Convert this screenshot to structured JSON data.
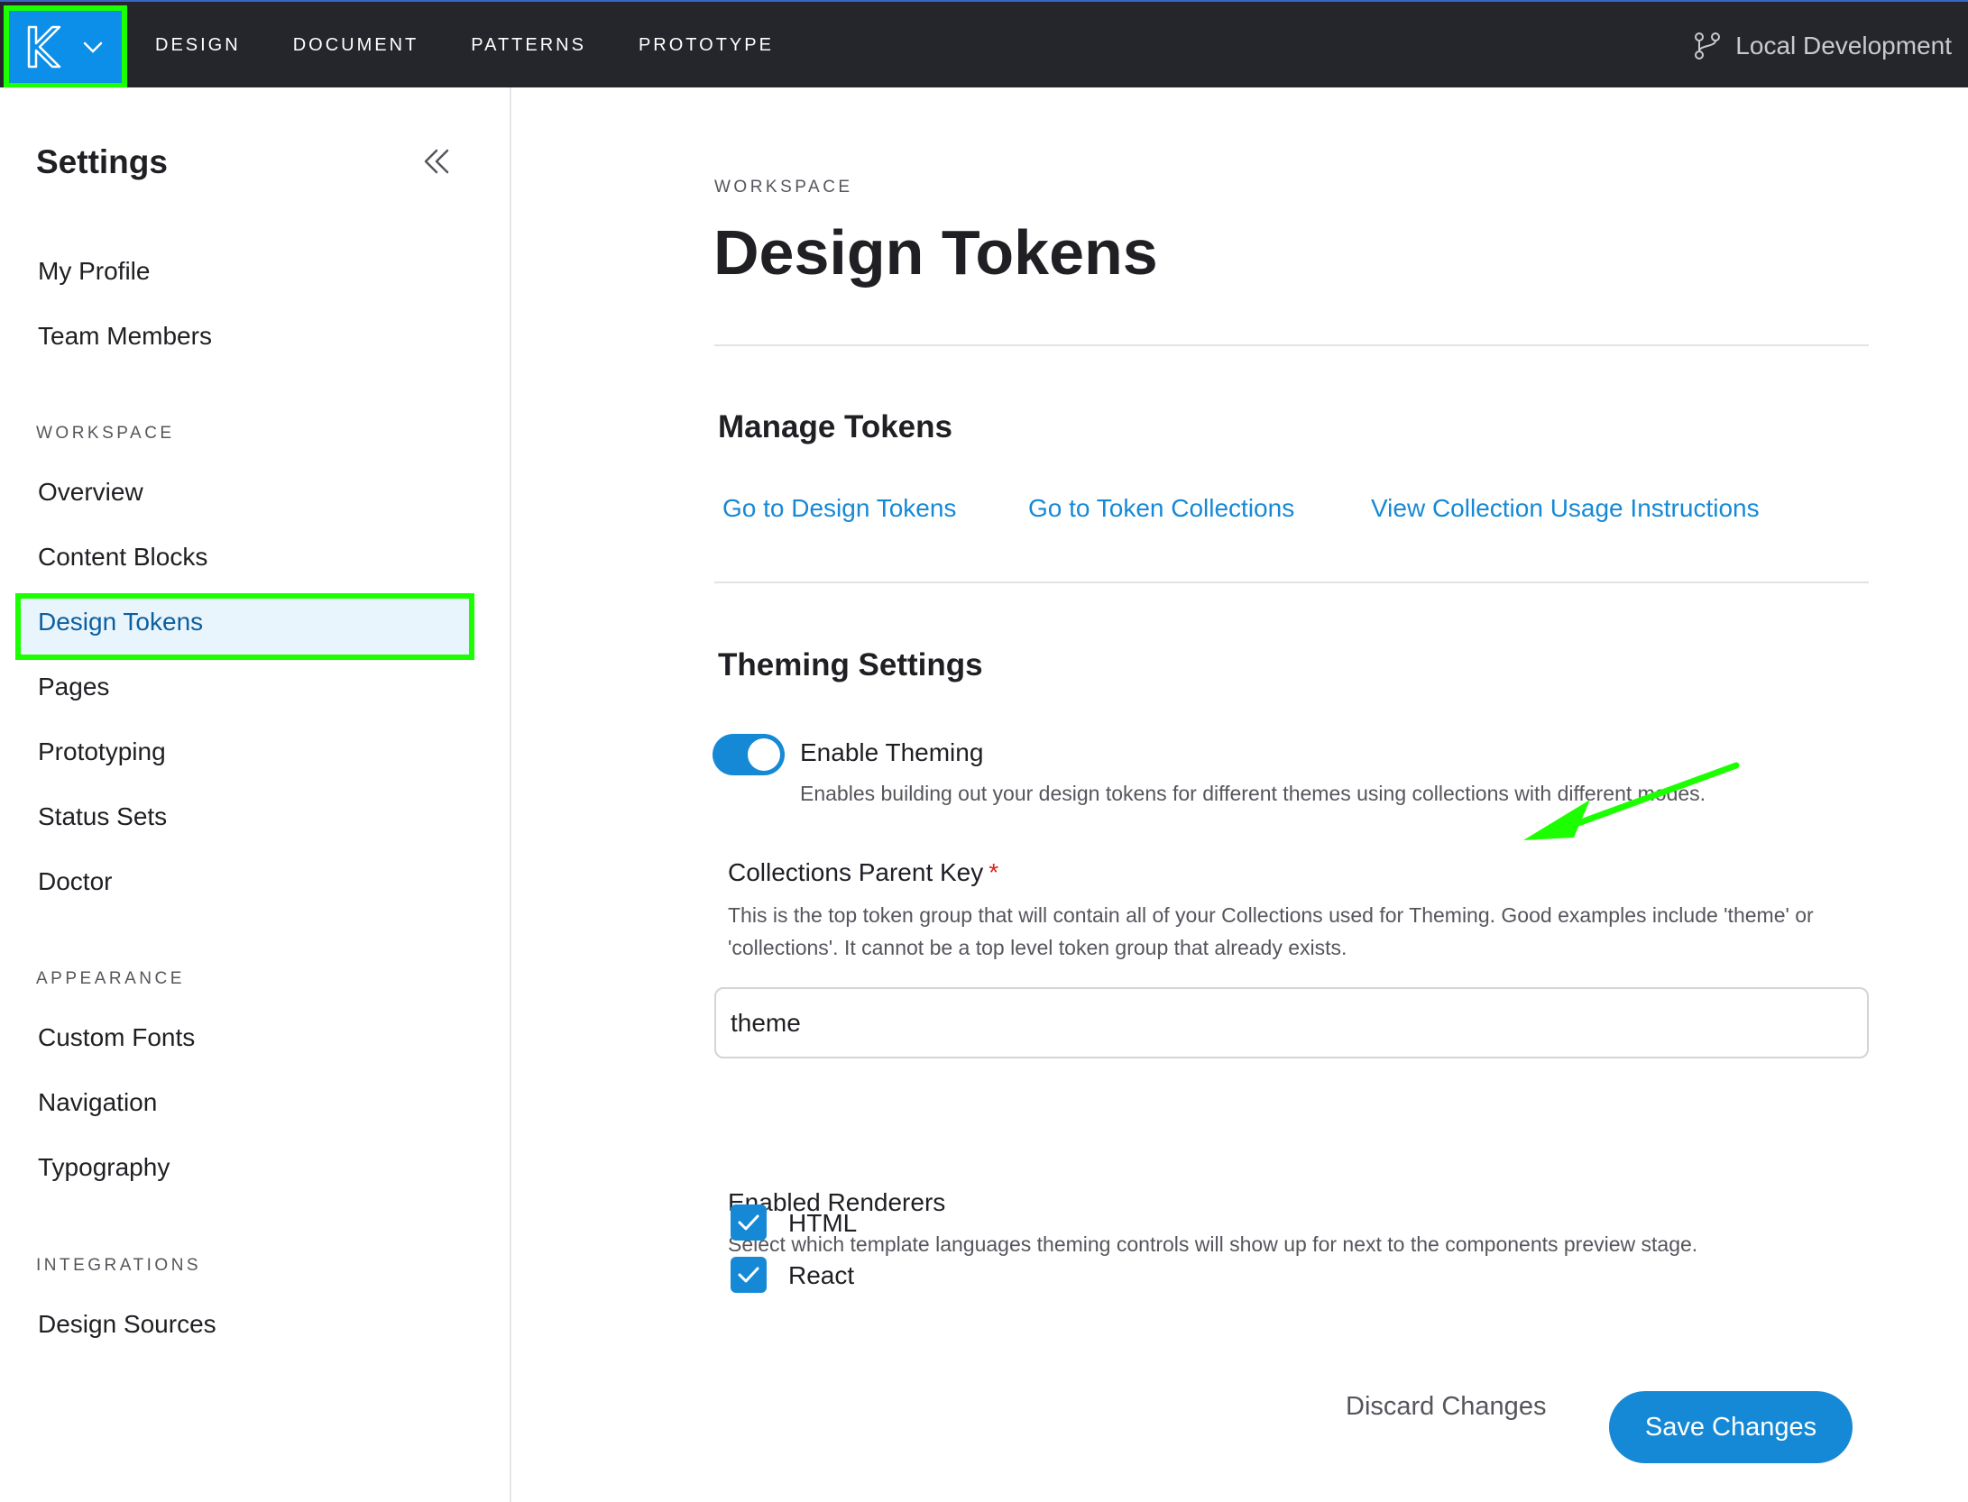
{
  "topbar": {
    "nav": [
      "DESIGN",
      "DOCUMENT",
      "PATTERNS",
      "PROTOTYPE"
    ],
    "branch_label": "Local Development"
  },
  "sidebar": {
    "title": "Settings",
    "items_top": [
      "My Profile",
      "Team Members"
    ],
    "workspace_heading": "WORKSPACE",
    "workspace_items": [
      "Overview",
      "Content Blocks",
      "Design Tokens",
      "Pages",
      "Prototyping",
      "Status Sets",
      "Doctor"
    ],
    "active_item": "Design Tokens",
    "appearance_heading": "APPEARANCE",
    "appearance_items": [
      "Custom Fonts",
      "Navigation",
      "Typography"
    ],
    "integrations_heading": "INTEGRATIONS",
    "integrations_items": [
      "Design Sources"
    ]
  },
  "main": {
    "eyebrow": "WORKSPACE",
    "title": "Design Tokens",
    "manage": {
      "heading": "Manage Tokens",
      "links": [
        "Go to Design Tokens",
        "Go to Token Collections",
        "View Collection Usage Instructions"
      ]
    },
    "theming": {
      "heading": "Theming Settings",
      "toggle_label": "Enable Theming",
      "toggle_on": true,
      "toggle_desc": "Enables building out your design tokens for different themes using collections with different modes.",
      "parent_key_label": "Collections Parent Key",
      "required_mark": "*",
      "parent_key_help": "This is the top token group that will contain all of your Collections used for Theming. Good examples include 'theme' or 'collections'. It cannot be a top level token group that already exists.",
      "parent_key_value": "theme",
      "renderers_label": "Enabled Renderers",
      "renderers_help": "Select which template languages theming controls will show up for next to the components preview stage.",
      "renderers": [
        {
          "label": "HTML",
          "checked": true
        },
        {
          "label": "React",
          "checked": true
        }
      ]
    },
    "actions": {
      "discard": "Discard Changes",
      "save": "Save Changes"
    }
  },
  "colors": {
    "accent": "#1689d6",
    "topbar": "#25262b",
    "highlight": "#1cff00"
  }
}
